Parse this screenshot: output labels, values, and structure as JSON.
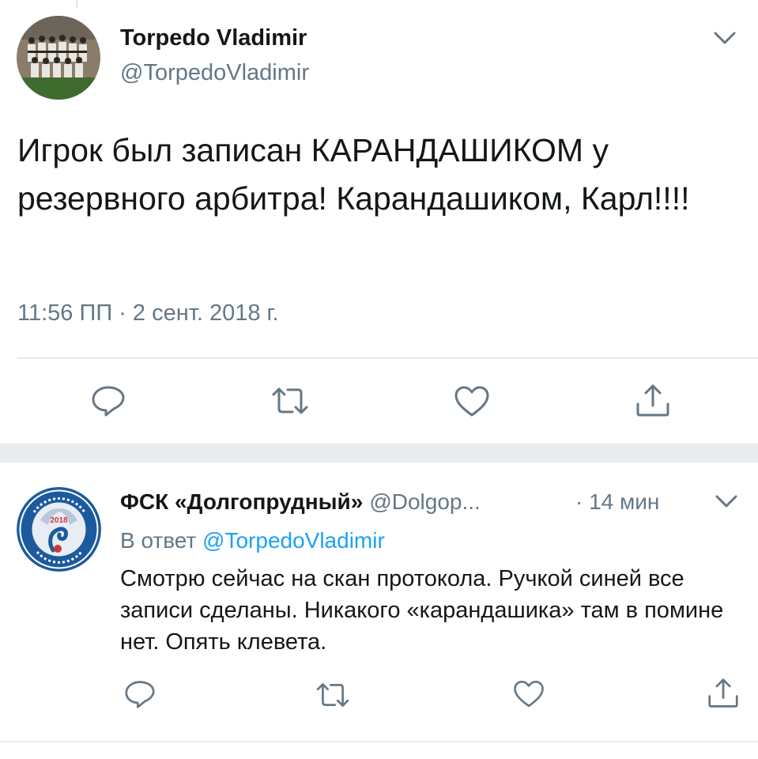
{
  "tweet": {
    "author_name": "Torpedo Vladimir",
    "author_handle": "@TorpedoVladimir",
    "text": "Игрок был записан КАРАНДАШИКОМ у резервного арбитра! Карандашиком, Карл!!!!",
    "meta": "11:56 ПП · 2 сент. 2018 г.",
    "avatar": "team-photo"
  },
  "reply": {
    "author_name": "ФСК «Долгопрудный»",
    "author_handle": "@Dolgop...",
    "time": "· 14 мин",
    "in_reply_prefix": "В ответ",
    "in_reply_handle": "@TorpedoVladimir",
    "text": "Смотрю сейчас на скан протокола. Ручкой синей все записи сделаны. Никакого «карандашика» там в помине нет. Опять клевета.",
    "avatar": "club-logo",
    "logo_year": "2018"
  },
  "icons": [
    "chevron-down-icon",
    "reply-icon",
    "retweet-icon",
    "like-icon",
    "share-icon"
  ],
  "colors": {
    "text": "#14171a",
    "secondary": "#657786",
    "link": "#1da1f2",
    "divider": "#e6ecf0",
    "background": "#ffffff"
  }
}
